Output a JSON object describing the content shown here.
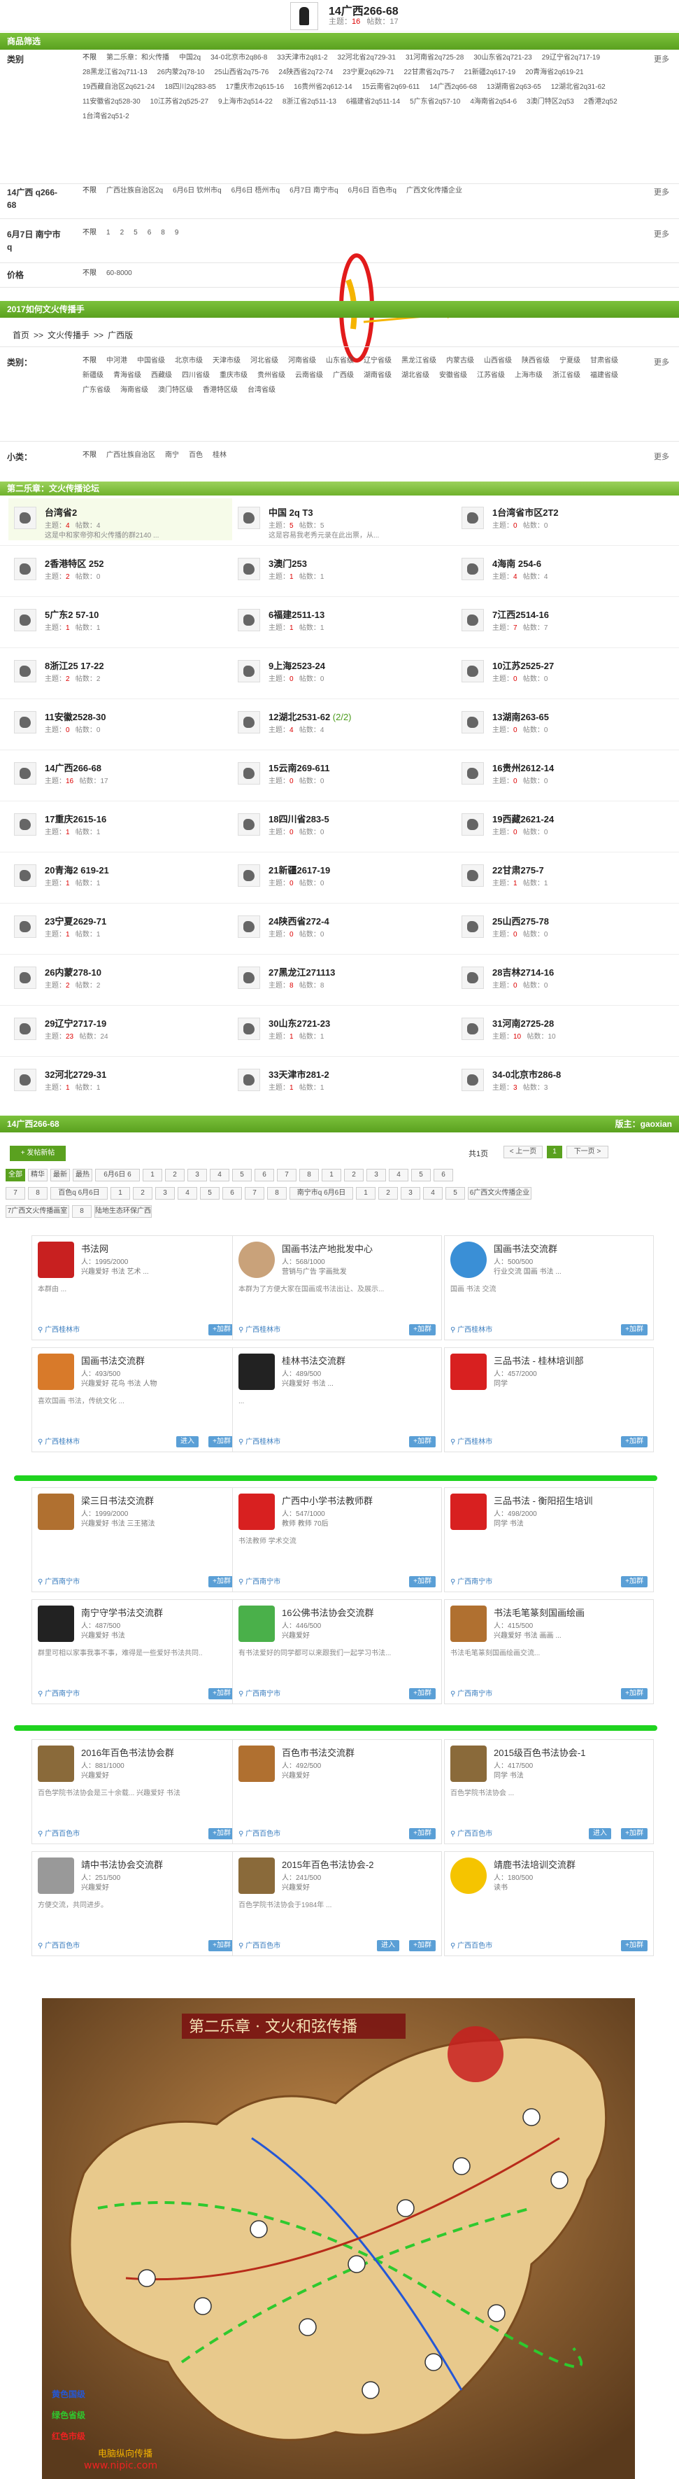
{
  "header": {
    "title": "14广西266-68",
    "topic_label": "主题：",
    "topic_count": "16",
    "posts_label": "帖数：",
    "posts_count": "17"
  },
  "filters": {
    "bar_title": "商品筛选",
    "category_label": "类别",
    "category_opts": [
      "不限",
      "第二乐章：和火传播",
      "中国2q",
      "34-0北京市2q86-8",
      "33天津市2q81-2",
      "32河北省2q729-31",
      "31河南省2q725-28",
      "30山东省2q721-23",
      "29辽宁省2q717-19",
      "28黑龙江省2q711-13",
      "26内蒙2q78-10",
      "25山西省2q75-76",
      "24陕西省2q72-74",
      "23宁夏2q629-71",
      "22甘肃省2q75-7",
      "21新疆2q617-19",
      "20青海省2q619-21",
      "19西藏自治区2q621-24",
      "18四川2q283-85",
      "17重庆市2q615-16",
      "16贵州省2q612-14",
      "15云南省2q69-611",
      "14广西2q66-68",
      "13湖南省2q63-65",
      "12湖北省2q31-62",
      "11安徽省2q528-30",
      "10江苏省2q525-27",
      "9上海市2q514-22",
      "8浙江省2q511-13",
      "6福建省2q511-14",
      "5广东省2q57-10",
      "4海南省2q54-6",
      "3澳门特区2q53",
      "2香港2q52",
      "1台湾省2q51-2"
    ],
    "more": "更多",
    "region_label": "14广西 q266-68",
    "region_opts": [
      "不限",
      "广西壮族自治区2q",
      "6月6日 钦州市q",
      "6月6日 梧州市q",
      "6月7日 南宁市q",
      "6月6日 百色市q",
      "广西文化传播企业"
    ],
    "date_label": "6月7日 南宁市q",
    "date_opts": [
      "不限",
      "1",
      "2",
      "5",
      "6",
      "8",
      "9"
    ],
    "price_label": "价格",
    "price_opts": [
      "不限",
      "60-8000"
    ]
  },
  "forum": {
    "bar_title": "2017如何文火传播手",
    "crumbs": [
      "首页",
      ">>",
      "文火传播手",
      ">>",
      "广西版"
    ],
    "class_label": "类别：",
    "class_opts": [
      "不限",
      "中河港",
      "中国省级",
      "北京市级",
      "天津市级",
      "河北省级",
      "河南省级",
      "山东省级",
      "辽宁省级",
      "黑龙江省级",
      "内蒙古级",
      "山西省级",
      "陕西省级",
      "宁夏级",
      "甘肃省级",
      "新疆级",
      "青海省级",
      "西藏级",
      "四川省级",
      "重庆市级",
      "贵州省级",
      "云南省级",
      "广西级",
      "湖南省级",
      "湖北省级",
      "安徽省级",
      "江苏省级",
      "上海市级",
      "浙江省级",
      "福建省级",
      "广东省级",
      "海南省级",
      "澳门特区级",
      "香港特区级",
      "台湾省级"
    ],
    "sub_label": "小类：",
    "sub_opts": [
      "不限",
      "广西壮族自治区",
      "南宁",
      "百色",
      "桂林"
    ],
    "more": "更多",
    "sub_bar": "第二乐章：文火传播论坛",
    "items": [
      {
        "name": "台湾省2",
        "topic": "4",
        "posts": "4",
        "desc": "这是中和家帝弥和火传播的群2140 ..."
      },
      {
        "name": "中国 2q T3",
        "topic": "5",
        "posts": "5",
        "desc": "这是容易我老秀元录在此出票，从..."
      },
      {
        "name": "1台湾省市区2T2",
        "topic": "0",
        "posts": "0",
        "desc": ""
      },
      {
        "name": "2香港特区 252",
        "topic": "2",
        "posts": "0",
        "desc": ""
      },
      {
        "name": "3澳门253",
        "topic": "1",
        "posts": "1",
        "desc": ""
      },
      {
        "name": "4海南 254-6",
        "topic": "4",
        "posts": "4",
        "desc": ""
      },
      {
        "name": "5广东2 57-10",
        "topic": "1",
        "posts": "1",
        "desc": ""
      },
      {
        "name": "6福建2511-13",
        "topic": "1",
        "posts": "1",
        "desc": ""
      },
      {
        "name": "7江西2514-16",
        "topic": "7",
        "posts": "7",
        "desc": ""
      },
      {
        "name": "8浙江25 17-22",
        "topic": "2",
        "posts": "2",
        "desc": ""
      },
      {
        "name": "9上海2523-24",
        "topic": "0",
        "posts": "0",
        "desc": ""
      },
      {
        "name": "10江苏2525-27",
        "topic": "0",
        "posts": "0",
        "desc": ""
      },
      {
        "name": "11安徽2528-30",
        "topic": "0",
        "posts": "0",
        "desc": ""
      },
      {
        "name": "12湖北2531-62",
        "extra": "(2/2)",
        "topic": "4",
        "posts": "4",
        "desc": ""
      },
      {
        "name": "13湖南263-65",
        "topic": "0",
        "posts": "0",
        "desc": ""
      },
      {
        "name": "14广西266-68",
        "topic": "16",
        "posts": "17",
        "desc": ""
      },
      {
        "name": "15云南269-611",
        "topic": "0",
        "posts": "0",
        "desc": ""
      },
      {
        "name": "16贵州2612-14",
        "topic": "0",
        "posts": "0",
        "desc": ""
      },
      {
        "name": "17重庆2615-16",
        "topic": "1",
        "posts": "1",
        "desc": ""
      },
      {
        "name": "18四川省283-5",
        "topic": "0",
        "posts": "0",
        "desc": ""
      },
      {
        "name": "19西藏2621-24",
        "topic": "0",
        "posts": "0",
        "desc": ""
      },
      {
        "name": "20青海2 619-21",
        "topic": "1",
        "posts": "1",
        "desc": ""
      },
      {
        "name": "21新疆2617-19",
        "topic": "0",
        "posts": "0",
        "desc": ""
      },
      {
        "name": "22甘肃275-7",
        "topic": "1",
        "posts": "1",
        "desc": ""
      },
      {
        "name": "23宁夏2629-71",
        "topic": "1",
        "posts": "1",
        "desc": ""
      },
      {
        "name": "24陕西省272-4",
        "topic": "0",
        "posts": "0",
        "desc": ""
      },
      {
        "name": "25山西275-78",
        "topic": "0",
        "posts": "0",
        "desc": ""
      },
      {
        "name": "26内蒙278-10",
        "topic": "2",
        "posts": "2",
        "desc": ""
      },
      {
        "name": "27黑龙江271113",
        "topic": "8",
        "posts": "8",
        "desc": ""
      },
      {
        "name": "28吉林2714-16",
        "topic": "0",
        "posts": "0",
        "desc": ""
      },
      {
        "name": "29辽宁2717-19",
        "topic": "23",
        "posts": "24",
        "desc": ""
      },
      {
        "name": "30山东2721-23",
        "topic": "1",
        "posts": "1",
        "desc": ""
      },
      {
        "name": "31河南2725-28",
        "topic": "10",
        "posts": "10",
        "desc": ""
      },
      {
        "name": "32河北2729-31",
        "topic": "1",
        "posts": "1",
        "desc": ""
      },
      {
        "name": "33天津市281-2",
        "topic": "1",
        "posts": "1",
        "desc": ""
      },
      {
        "name": "34-0北京市286-8",
        "topic": "3",
        "posts": "3",
        "desc": ""
      }
    ],
    "topic_label": "主题：",
    "posts_label": "帖数："
  },
  "threads": {
    "bar_title": "14广西266-68",
    "moderator": "版主：gaoxian",
    "new_post": "+ 发帖新帖",
    "pages_label": "共1页",
    "prev": "< 上一页",
    "cur_page": "1",
    "next": "下一页 >",
    "tabs": [
      "全部",
      "精华",
      "最新",
      "最热",
      "6月6日 6",
      "1",
      "2",
      "3",
      "4",
      "5",
      "6",
      "7",
      "8",
      "1",
      "2",
      "3",
      "4",
      "5",
      "6"
    ],
    "tabs2": [
      "7",
      "8",
      "百色q 6月6日",
      "1",
      "2",
      "3",
      "4",
      "5",
      "6",
      "7",
      "8",
      "南宁市q 6月6日",
      "1",
      "2",
      "3",
      "4",
      "5",
      "6广西文火传播企业"
    ],
    "tabs3": [
      "7广西文火传播画室",
      "8",
      "陆地生态环保广西"
    ]
  },
  "groups": [
    {
      "name": "书法网",
      "mem": "1995/2000",
      "tags": "兴趣爱好 书法 艺术 ...",
      "desc": "本群由 ...",
      "loc": "广西桂林市",
      "join": "+加群",
      "logo": "书法"
    },
    {
      "name": "国画书法产地批发中心",
      "mem": "568/1000",
      "tags": "营销与广告 字画批发",
      "desc": "本群为了方便大家在国画或书法出让、及展示...",
      "loc": "广西桂林市",
      "join": "+加群",
      "logo": "person"
    },
    {
      "name": "国画书法交流群",
      "mem": "500/500",
      "tags": "行业交流 国画 书法 ...",
      "desc": "国画 书法 交流",
      "loc": "广西桂林市",
      "join": "+加群",
      "logo": "avatar"
    },
    {
      "name": "国画书法交流群",
      "mem": "493/500",
      "tags": "兴趣爱好 花鸟 书法 人物",
      "desc": "喜欢国画 书法，传统文化 ...",
      "loc": "广西桂林市",
      "join": "+加群",
      "enter": "进入",
      "logo": "painting"
    },
    {
      "name": "桂林书法交流群",
      "mem": "489/500",
      "tags": "兴趣爱好 书法 ...",
      "desc": "...",
      "loc": "广西桂林市",
      "join": "+加群",
      "logo": "ink"
    },
    {
      "name": "三品书法 - 桂林培训部",
      "mem": "457/2000",
      "tags": "同学",
      "desc": "",
      "loc": "广西桂林市",
      "join": "+加群",
      "logo": "red"
    },
    {
      "name": "梁三日书法交流群",
      "mem": "1999/2000",
      "tags": "兴趣爱好 书法 三王猪法",
      "desc": "",
      "loc": "广西南宁市",
      "join": "+加群",
      "logo": "shu"
    },
    {
      "name": "广西中小学书法教师群",
      "mem": "547/1000",
      "tags": "教师 教师 70后",
      "desc": "书法教师 学术交流",
      "loc": "广西南宁市",
      "join": "+加群",
      "logo": "red"
    },
    {
      "name": "三品书法 - 衡阳招生培训",
      "mem": "498/2000",
      "tags": "同学 书法",
      "desc": "",
      "loc": "广西南宁市",
      "join": "+加群",
      "logo": "red"
    },
    {
      "name": "南宁守学书法交流群",
      "mem": "487/500",
      "tags": "兴趣爱好 书法",
      "desc": "群里可相以家事我事不事，难得是一些爱好书法共同..",
      "loc": "广西南宁市",
      "join": "+加群",
      "logo": "ink"
    },
    {
      "name": "16公佛书法协会交流群",
      "mem": "446/500",
      "tags": "兴趣爱好",
      "desc": "有书法爱好的同学都可以来跟我们一起学习书法...",
      "loc": "广西南宁市",
      "join": "+加群",
      "logo": "avatar2"
    },
    {
      "name": "书法毛笔篆刻国画绘画",
      "mem": "415/500",
      "tags": "兴趣爱好 书法 画画 ...",
      "desc": "书法毛笔篆刻国画绘画交流...",
      "loc": "广西南宁市",
      "join": "+加群",
      "logo": "shu"
    },
    {
      "name": "2016年百色书法协会群",
      "mem": "881/1000",
      "tags": "兴趣爱好",
      "desc": "百色学院书法协会是三十余载... 兴趣爱好 书法",
      "loc": "广西百色市",
      "join": "+加群",
      "logo": "seal"
    },
    {
      "name": "百色市书法交流群",
      "mem": "492/500",
      "tags": "兴趣爱好",
      "desc": "",
      "loc": "广西百色市",
      "join": "+加群",
      "logo": "shu"
    },
    {
      "name": "2015级百色书法协会-1",
      "mem": "417/500",
      "tags": "同学 书法",
      "desc": "百色学院书法协会 ...",
      "loc": "广西百色市",
      "join": "+加群",
      "enter": "进入",
      "logo": "seal"
    },
    {
      "name": "靖中书法协会交流群",
      "mem": "251/500",
      "tags": "兴趣爱好",
      "desc": "方便交流，共同进步。",
      "loc": "广西百色市",
      "join": "+加群",
      "logo": "compass"
    },
    {
      "name": "2015年百色书法协会-2",
      "mem": "241/500",
      "tags": "兴趣爱好",
      "desc": "百色学院书法协会于1984年 ...",
      "loc": "广西百色市",
      "join": "+加群",
      "enter": "进入",
      "logo": "seal"
    },
    {
      "name": "靖鹿书法培训交流群",
      "mem": "180/500",
      "tags": "读书",
      "desc": "",
      "loc": "广西百色市",
      "join": "+加群",
      "logo": "heart"
    }
  ],
  "group_labels": {
    "members": "人："
  },
  "map": {
    "title": "第二乐章 · 文火和弦传播",
    "legend": [
      "黄色国级",
      "绿色省级",
      "红色市级"
    ],
    "watermark": "www.nipic.com",
    "caption": "电脑纵向传播"
  }
}
